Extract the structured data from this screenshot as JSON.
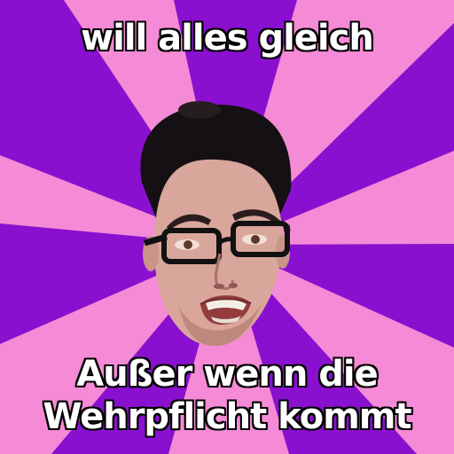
{
  "meme": {
    "top_text": "will alles gleich",
    "bottom_lines": [
      "Außer wenn die",
      "Wehrpflicht kommt"
    ]
  },
  "colors": {
    "background_purple": "#8a10cf",
    "ray_pink": "#f58ad6",
    "caption_text": "#ffffff",
    "caption_outline": "#000000"
  }
}
